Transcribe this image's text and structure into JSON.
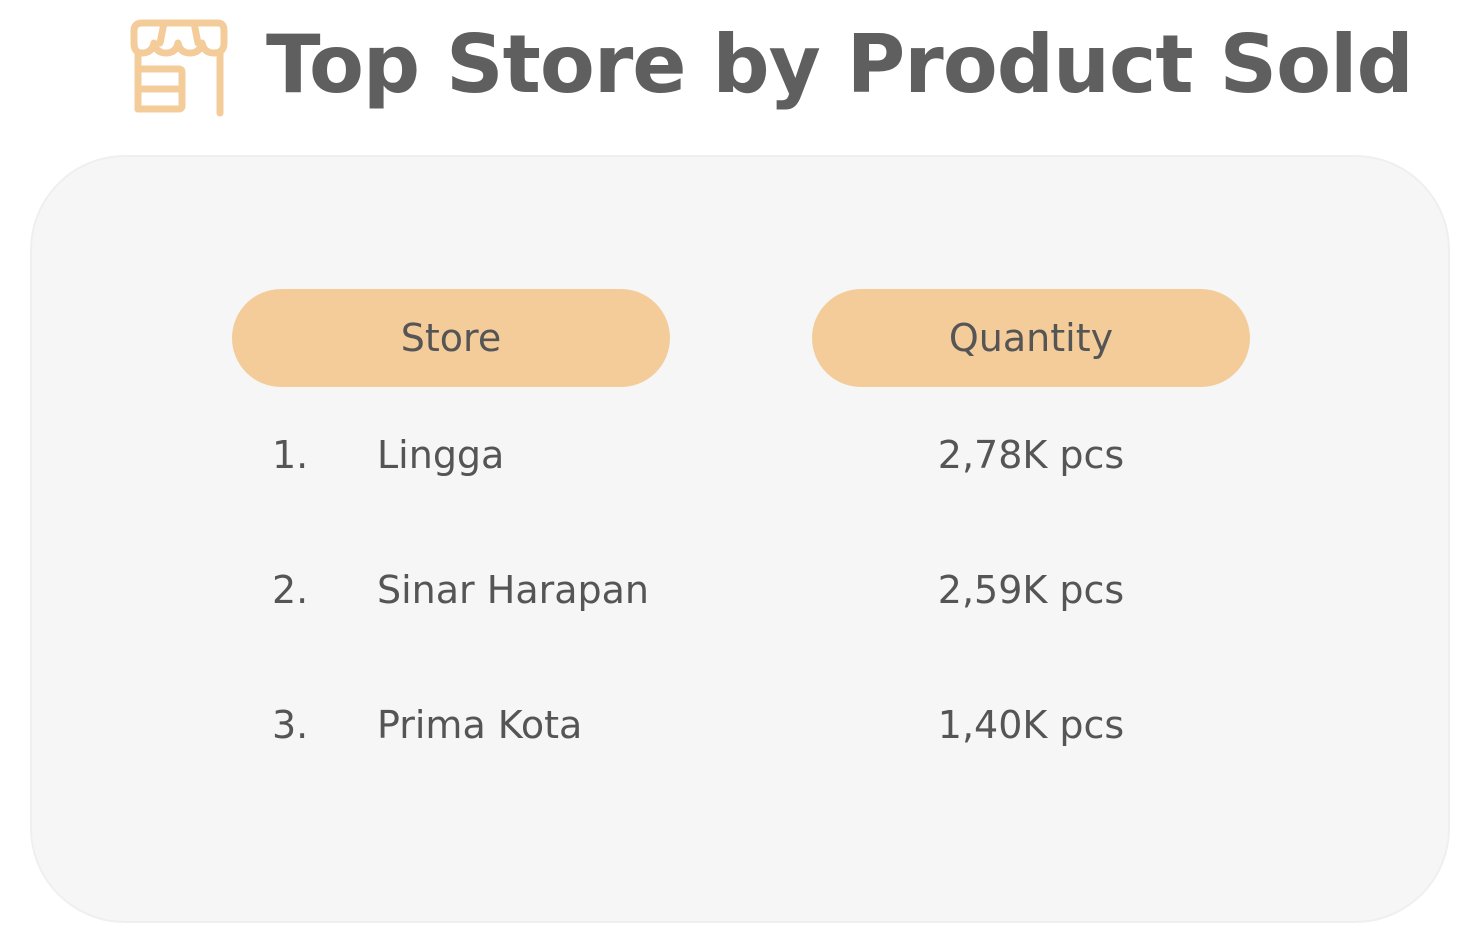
{
  "title": "Top Store by Product Sold",
  "icon": "store-icon",
  "colors": {
    "accent": "#F4CC9A",
    "title": "#5F5F5F",
    "text": "#555555",
    "card_background": "#F6F6F6"
  },
  "chart_data": {
    "type": "table",
    "columns": [
      "Store",
      "Quantity"
    ],
    "rows": [
      {
        "rank": "1.",
        "store": "Lingga",
        "quantity": "2,78K pcs"
      },
      {
        "rank": "2.",
        "store": "Sinar Harapan",
        "quantity": "2,59K pcs"
      },
      {
        "rank": "3.",
        "store": "Prima Kota",
        "quantity": "1,40K pcs"
      }
    ]
  }
}
